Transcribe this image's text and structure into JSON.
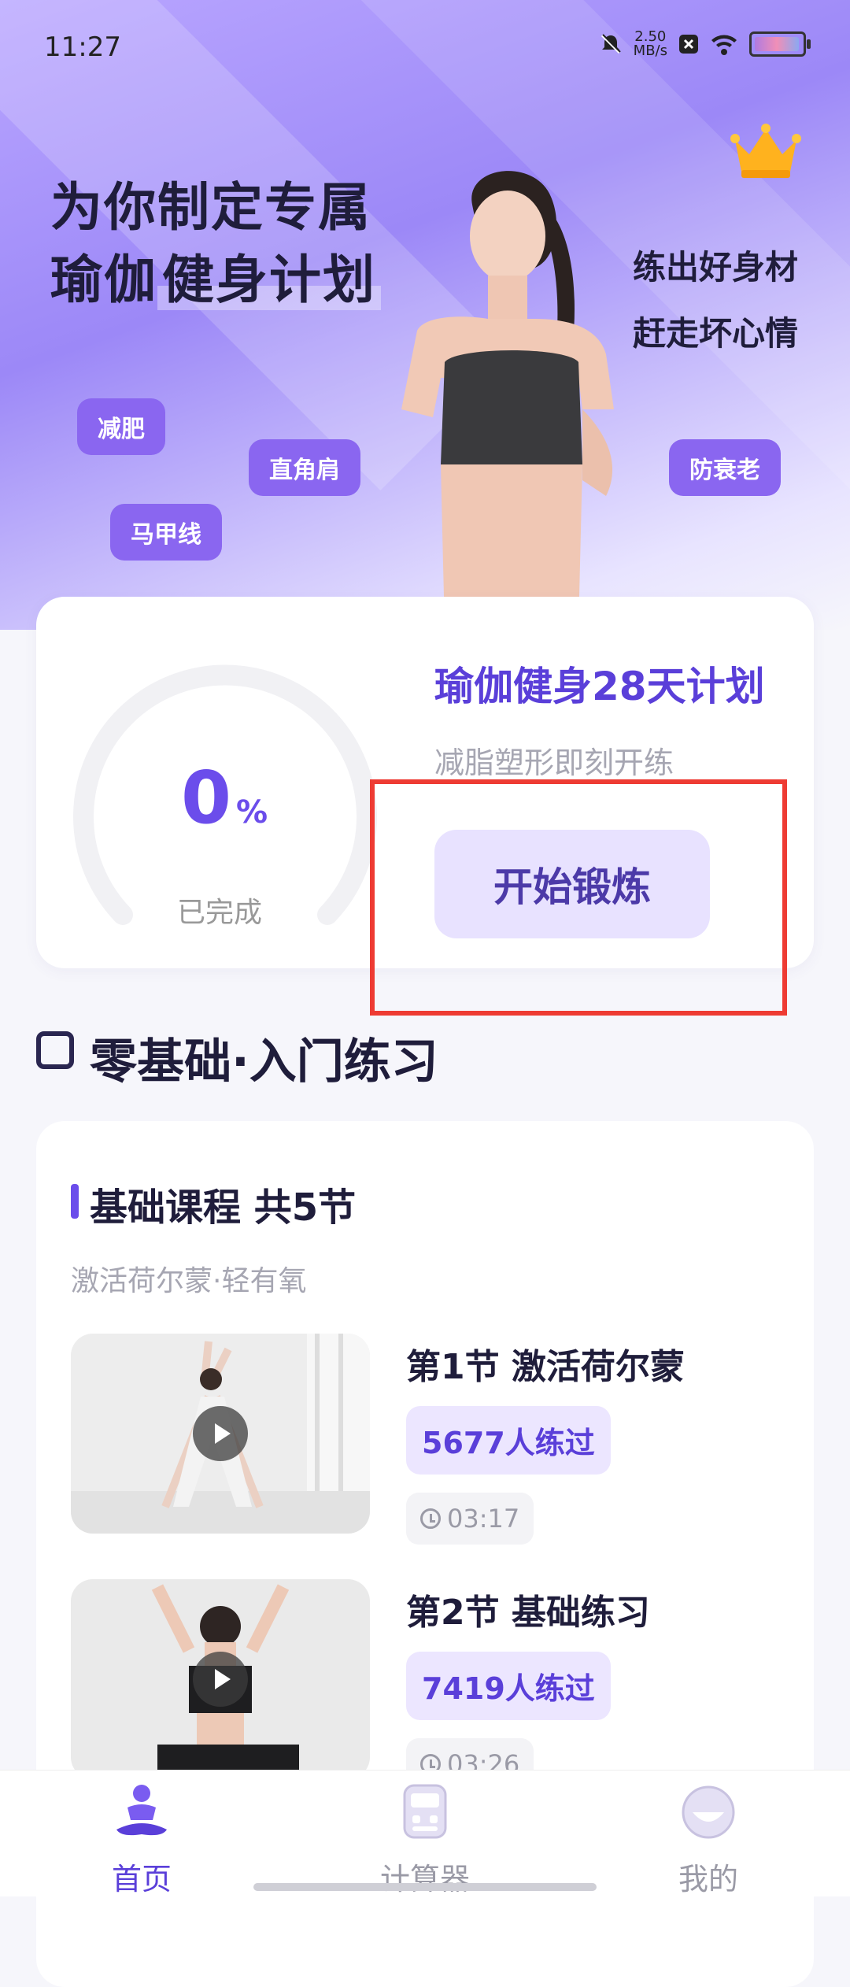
{
  "status_bar": {
    "time": "11:27",
    "speed_value": "2.50",
    "speed_unit": "MB/s"
  },
  "hero": {
    "headline_line1": "为你制定专属",
    "headline_line2_a": "瑜伽",
    "headline_line2_b": "健身计划",
    "slogan1": "练出好身材",
    "slogan2": "赶走坏心情",
    "tags": [
      "减肥",
      "直角肩",
      "防衰老",
      "马甲线"
    ]
  },
  "plan": {
    "progress_value": "0",
    "progress_unit": "%",
    "progress_label": "已完成",
    "title": "瑜伽健身28天计划",
    "subtitle": "减脂塑形即刻开练",
    "start_button": "开始锻炼"
  },
  "section": {
    "title": "零基础·入门练习"
  },
  "course": {
    "title": "基础课程 共5节",
    "subtitle": "激活荷尔蒙·轻有氧",
    "lessons": [
      {
        "title": "第1节 激活荷尔蒙",
        "learners": "5677人练过",
        "duration": "03:17"
      },
      {
        "title": "第2节 基础练习",
        "learners": "7419人练过",
        "duration": "03:26"
      }
    ]
  },
  "nav": {
    "items": [
      {
        "label": "首页",
        "icon": "yoga-person-icon"
      },
      {
        "label": "计算器",
        "icon": "calculator-icon"
      },
      {
        "label": "我的",
        "icon": "smiley-face-icon"
      }
    ]
  },
  "colors": {
    "accent": "#6B4DEB",
    "highlight_border": "#EE3B33"
  }
}
